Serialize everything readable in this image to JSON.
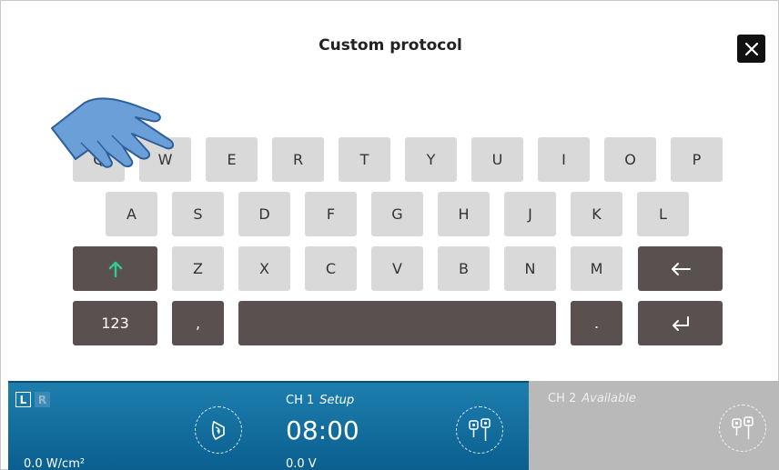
{
  "header": {
    "title": "Custom protocol",
    "close_icon": "close-icon"
  },
  "keyboard": {
    "row1": [
      "Q",
      "W",
      "E",
      "R",
      "T",
      "Y",
      "U",
      "I",
      "O",
      "P"
    ],
    "row2": [
      "A",
      "S",
      "D",
      "F",
      "G",
      "H",
      "J",
      "K",
      "L"
    ],
    "row3": [
      "Z",
      "X",
      "C",
      "V",
      "B",
      "N",
      "M"
    ],
    "numbers_label": "123",
    "comma_label": ",",
    "period_label": ".",
    "shift_icon": "arrow-up-icon",
    "backspace_icon": "arrow-left-icon",
    "enter_icon": "enter-icon",
    "colors": {
      "key": "#d9d9d9",
      "dark_key": "#5a5050",
      "shift_arrow": "#2ecc8f"
    }
  },
  "status_bar": {
    "ch1": {
      "badge_l": "L",
      "badge_r": "R",
      "channel": "CH 1",
      "state": "Setup",
      "timer": "08:00",
      "power": "0.0 W/cm²",
      "voltage": "0.0 V",
      "color": "#1070a0"
    },
    "ch2": {
      "channel": "CH 2",
      "state": "Available",
      "color": "#b9b9b9"
    }
  }
}
